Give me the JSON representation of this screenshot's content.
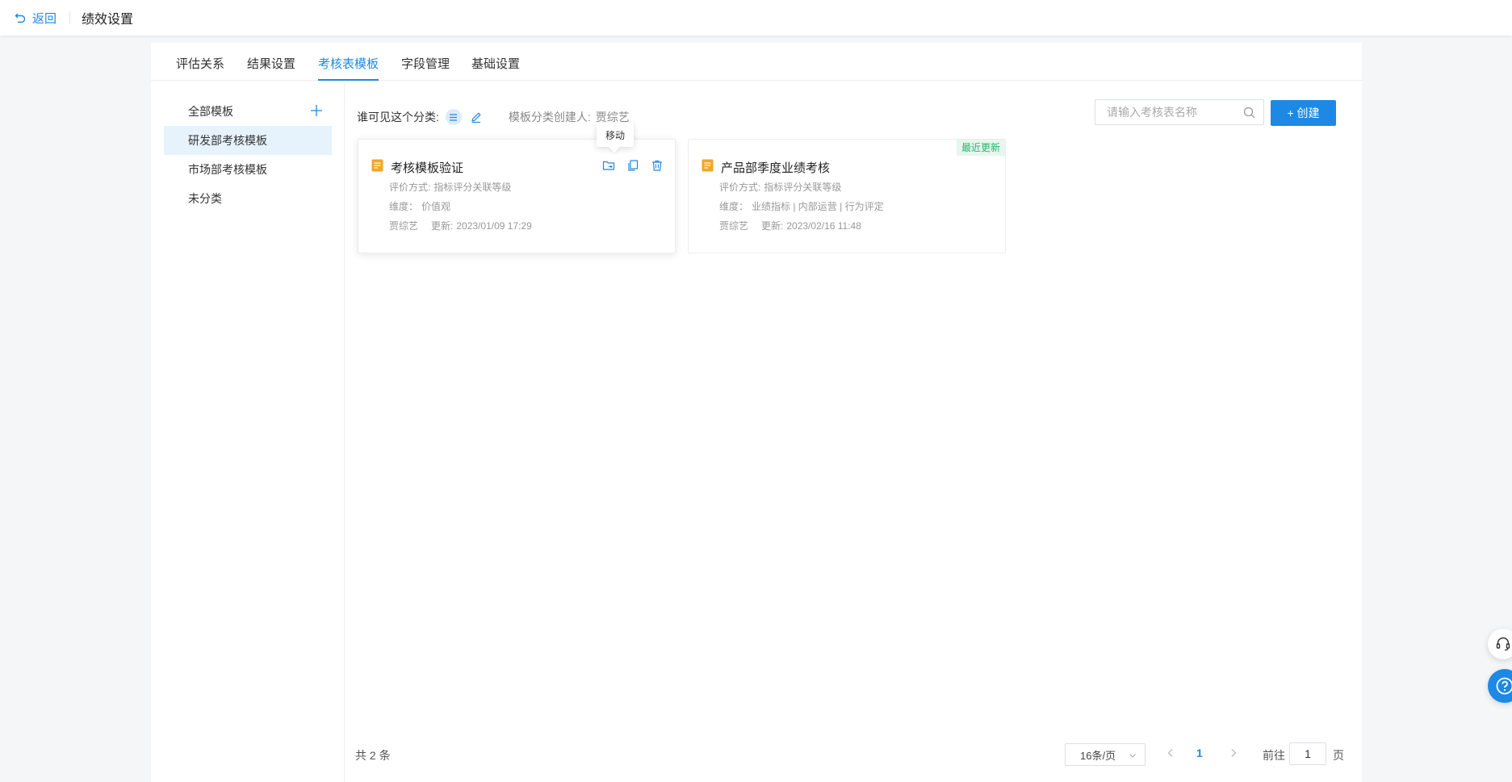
{
  "header": {
    "back_label": "返回",
    "title": "绩效设置"
  },
  "tabs": [
    {
      "label": "评估关系",
      "active": false
    },
    {
      "label": "结果设置",
      "active": false
    },
    {
      "label": "考核表模板",
      "active": true
    },
    {
      "label": "字段管理",
      "active": false
    },
    {
      "label": "基础设置",
      "active": false
    }
  ],
  "sidebar": {
    "items": [
      {
        "label": "全部模板",
        "active": false
      },
      {
        "label": "研发部考核模板",
        "active": true
      },
      {
        "label": "市场部考核模板",
        "active": false
      },
      {
        "label": "未分类",
        "active": false
      }
    ]
  },
  "toolbar": {
    "visibility_label": "谁可见这个分类:",
    "creator_label": "模板分类创建人:",
    "creator_name": "贾综艺",
    "search_placeholder": "请输入考核表名称",
    "create_label": "+ 创建"
  },
  "tooltip": "移动",
  "cards": [
    {
      "title": "考核模板验证",
      "method_label": "评价方式:",
      "method_value": "指标评分关联等级",
      "dimension_label": "维度：",
      "dimension_value": "价值观",
      "author": "贾综艺",
      "updated_label": "更新:",
      "updated_value": "2023/01/09 17:29",
      "badge": ""
    },
    {
      "title": "产品部季度业绩考核",
      "method_label": "评价方式:",
      "method_value": "指标评分关联等级",
      "dimension_label": "维度：",
      "dimension_value": "业绩指标 | 内部运营 | 行为评定",
      "author": "贾综艺",
      "updated_label": "更新:",
      "updated_value": "2023/02/16 11:48",
      "badge": "最近更新"
    }
  ],
  "pagination": {
    "total_text": "共 2 条",
    "page_size": "16条/页",
    "current_page": "1",
    "goto_label": "前往",
    "goto_value": "1",
    "page_unit": "页"
  },
  "colors": {
    "accent": "#1e88e5",
    "badge_green": "#2cb36b",
    "doc_orange": "#f5a623"
  }
}
